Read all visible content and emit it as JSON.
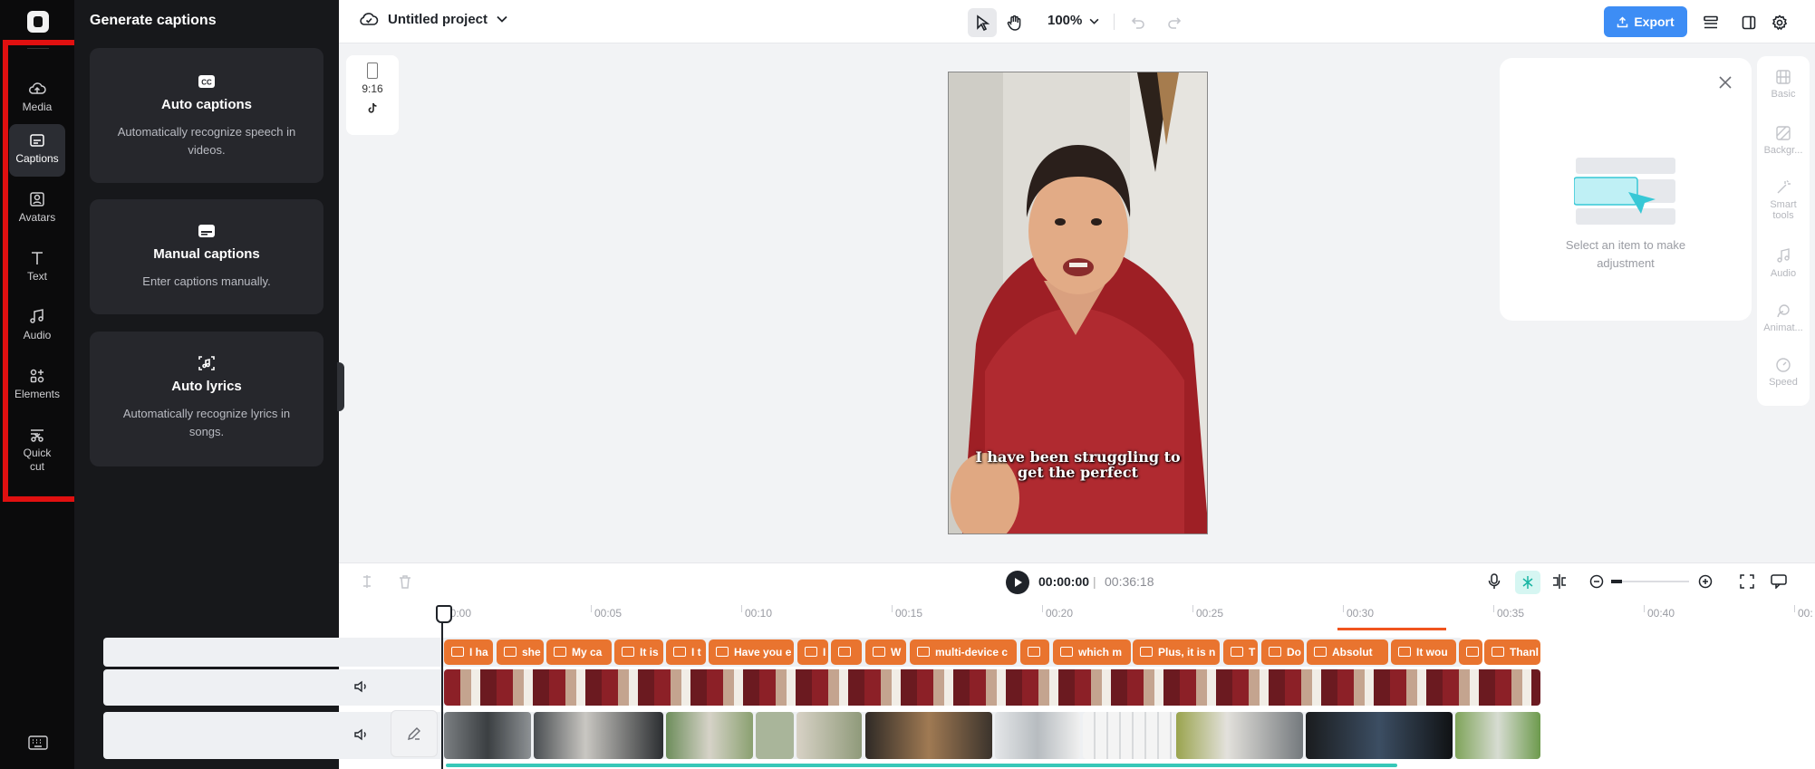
{
  "rail": {
    "items": [
      {
        "label": "Media",
        "icon": "cloud-upload-icon"
      },
      {
        "label": "Captions",
        "icon": "captions-icon"
      },
      {
        "label": "Avatars",
        "icon": "avatar-icon"
      },
      {
        "label": "Text",
        "icon": "text-icon"
      },
      {
        "label": "Audio",
        "icon": "music-note-icon"
      },
      {
        "label": "Elements",
        "icon": "elements-icon"
      },
      {
        "label": "Quick cut",
        "icon": "scissors-icon"
      }
    ],
    "active": "Captions",
    "highlight_color": "#e01010"
  },
  "panel": {
    "title": "Generate captions",
    "cards": [
      {
        "title": "Auto captions",
        "desc": "Automatically recognize speech in videos.",
        "icon": "cc-icon"
      },
      {
        "title": "Manual captions",
        "desc": "Enter captions manually.",
        "icon": "subtitle-icon"
      },
      {
        "title": "Auto lyrics",
        "desc": "Automatically recognize lyrics in songs.",
        "icon": "music-scan-icon"
      }
    ]
  },
  "topbar": {
    "project_name": "Untitled project",
    "zoom": "100%",
    "export_label": "Export"
  },
  "canvas": {
    "ratio_label": "9:16",
    "video_caption_line1": "I have been struggling to",
    "video_caption_line2": "get the perfect"
  },
  "properties": {
    "empty_text": "Select an item to make adjustment",
    "tabs": [
      "Basic",
      "Backgr...",
      "Smart tools",
      "Audio",
      "Animat...",
      "Speed"
    ]
  },
  "timeline": {
    "current_time": "00:00:00",
    "separator": "|",
    "total_time": "00:36:18",
    "ruler": [
      "00:00",
      "00:05",
      "00:10",
      "00:15",
      "00:20",
      "00:25",
      "00:30",
      "00:35",
      "00:40",
      "00:"
    ],
    "caption_clips": [
      "I ha",
      "she",
      "My ca",
      "It is",
      "I t",
      "Have you e",
      "I",
      "",
      "W",
      "multi-device c",
      "",
      "which m",
      "Plus, it is n",
      "T",
      "Do",
      "Absolut",
      "It wou",
      "",
      "Thanl"
    ]
  },
  "colors": {
    "accent": "#3d8df5",
    "caption_clip": "#e9742f",
    "dark_bg": "#0b0b0c",
    "panel_bg": "#17181b"
  }
}
